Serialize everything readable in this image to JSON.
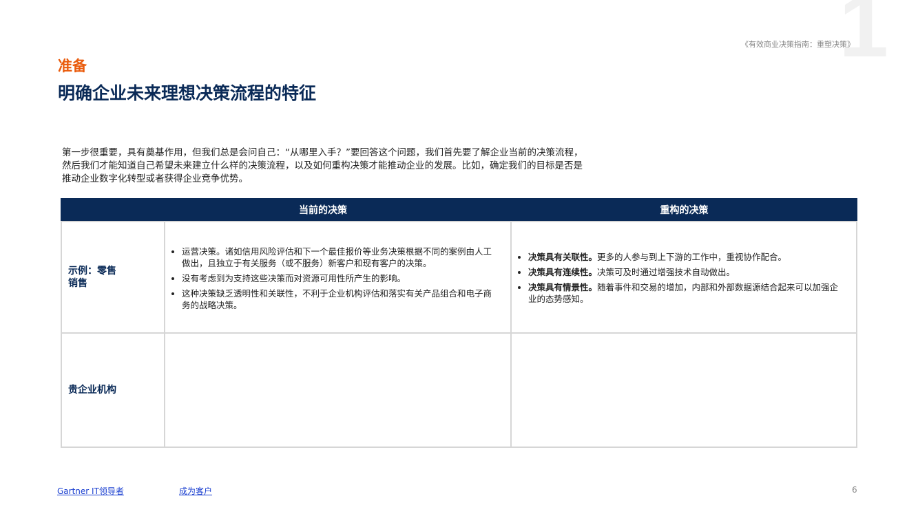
{
  "watermark": "1",
  "doc_title": "《有效商业决策指南：重塑决策》",
  "section": "准备",
  "title": "明确企业未来理想决策流程的特征",
  "intro": "第一步很重要，具有奠基作用，但我们总是会问自己：“从哪里入手？”要回答这个问题，我们首先要了解企业当前的决策流程，然后我们才能知道自己希望未来建立什么样的决策流程，以及如何重构决策才能推动企业的发展。比如，确定我们的目标是否是推动企业数字化转型或者获得企业竞争优势。",
  "table": {
    "headers": [
      "当前的决策",
      "重构的决策"
    ],
    "rows": [
      {
        "label": "示例：零售\n销售",
        "current": [
          "运营决策。诸如信用风险评估和下一个最佳报价等业务决策根据不同的案例由人工做出，且独立于有关服务（或不服务）新客户和现有客户的决策。",
          "没有考虑到为支持这些决策而对资源可用性所产生的影响。",
          "这种决策缺乏透明性和关联性，不利于企业机构评估和落实有关产品组合和电子商务的战略决策。"
        ],
        "reframed": [
          {
            "bold": "决策具有关联性。",
            "text": "更多的人参与到上下游的工作中，重视协作配合。"
          },
          {
            "bold": "决策具有连续性。",
            "text": "决策可及时通过增强技术自动做出。"
          },
          {
            "bold": "决策具有情景性。",
            "text": "随着事件和交易的增加，内部和外部数据源结合起来可以加强企业的态势感知。"
          }
        ]
      },
      {
        "label": "贵企业机构"
      }
    ]
  },
  "footer": {
    "link1": "Gartner IT领导者",
    "link2": "成为客户",
    "page": "6"
  }
}
